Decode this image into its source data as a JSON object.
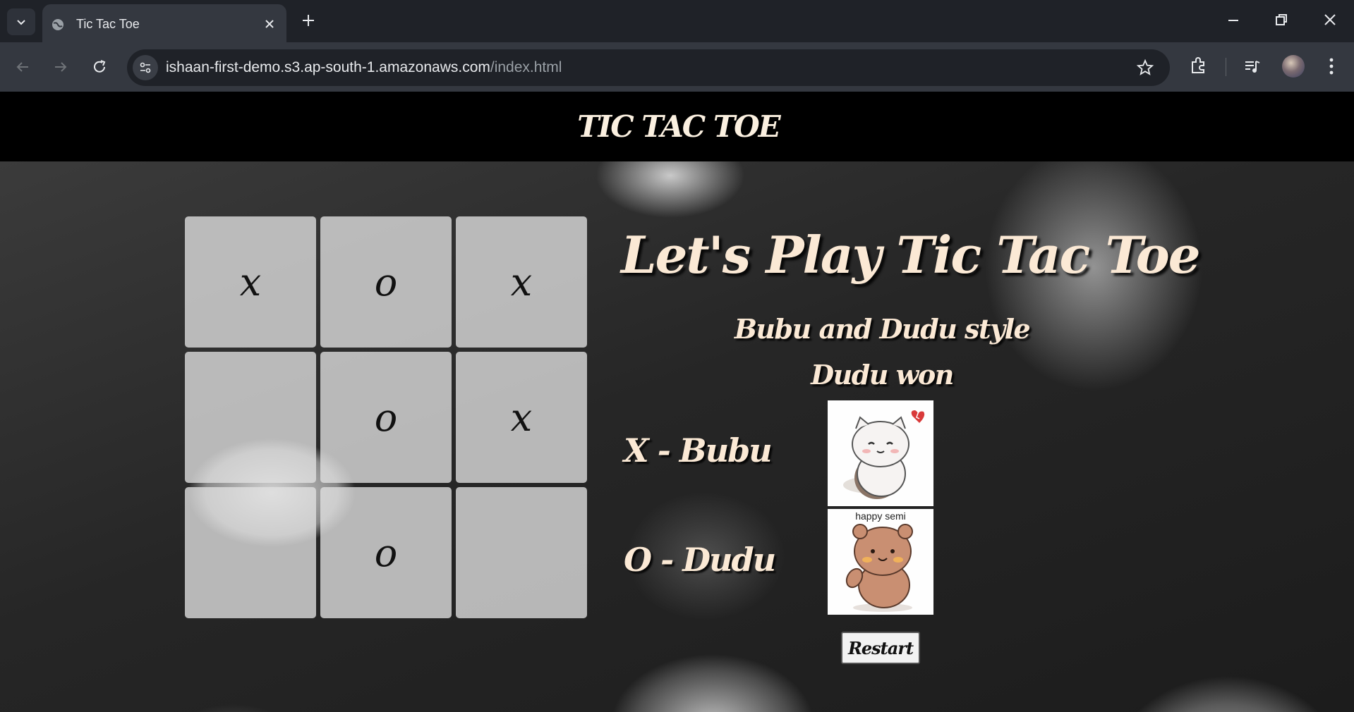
{
  "browser": {
    "tab_title": "Tic Tac Toe",
    "url_host": "ishaan-first-demo.s3.ap-south-1.amazonaws.com",
    "url_path": "/index.html",
    "icons": [
      "chevron-down-icon",
      "globe-icon",
      "close-icon",
      "plus-icon",
      "minimize-icon",
      "restore-icon",
      "back-icon",
      "forward-icon",
      "reload-icon",
      "site-info-icon",
      "star-icon",
      "extensions-icon",
      "media-icon",
      "avatar",
      "menu-icon"
    ]
  },
  "page": {
    "header_title": "TIC TAC TOE",
    "headline": "Let's Play Tic Tac Toe",
    "subline": "Bubu and Dudu style",
    "status": "Dudu won",
    "board": [
      "x",
      "o",
      "x",
      "",
      "o",
      "x",
      "",
      "o",
      ""
    ],
    "player_x_label": "X - Bubu",
    "player_o_label": "O - Dudu",
    "sticker_o_caption": "happy semi",
    "restart_label": "Restart"
  },
  "colors": {
    "header_bg": "#000000",
    "title_text": "#fbe9d5",
    "cell_bg": "#e1e1e1"
  }
}
